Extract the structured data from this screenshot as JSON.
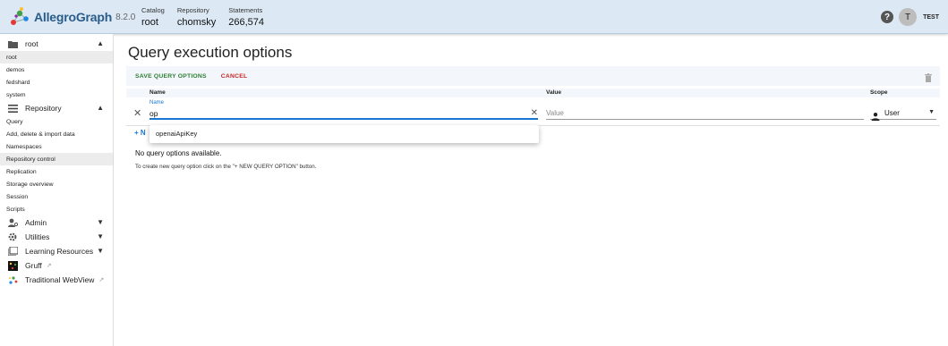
{
  "header": {
    "app_name": "AllegroGraph",
    "version": "8.2.0",
    "catalog_label": "Catalog",
    "catalog_value": "root",
    "repository_label": "Repository",
    "repository_value": "chomsky",
    "statements_label": "Statements",
    "statements_value": "266,574",
    "help_icon": "?",
    "avatar_initial": "T",
    "user_name": "TEST"
  },
  "sidebar": {
    "catalog_group": "root",
    "catalogs": [
      "root",
      "demos",
      "fedshard",
      "system"
    ],
    "repository_group": "Repository",
    "repository_items": [
      "Query",
      "Add, delete & import data",
      "Namespaces",
      "Repository control",
      "Replication",
      "Storage overview",
      "Session",
      "Scripts"
    ],
    "admin": "Admin",
    "utilities": "Utilities",
    "learning": "Learning Resources",
    "gruff": "Gruff",
    "webview": "Traditional WebView",
    "active_item": "Repository control"
  },
  "main": {
    "title": "Query execution options",
    "save_label": "SAVE QUERY OPTIONS",
    "cancel_label": "CANCEL",
    "col_name": "Name",
    "col_value": "Value",
    "col_scope": "Scope",
    "name_field_label": "Name",
    "name_field_value": "op",
    "value_placeholder": "Value",
    "scope_value": "User",
    "add_label": "+ N",
    "autocomplete_option": "openaiApiKey",
    "empty_title": "No query options available.",
    "empty_hint": "To create new query option click on the \"+ NEW QUERY OPTION\" button."
  },
  "colors": {
    "header_bg": "#dce9f5",
    "save": "#2e7d32",
    "cancel": "#c62828",
    "accent": "#1976d2"
  }
}
